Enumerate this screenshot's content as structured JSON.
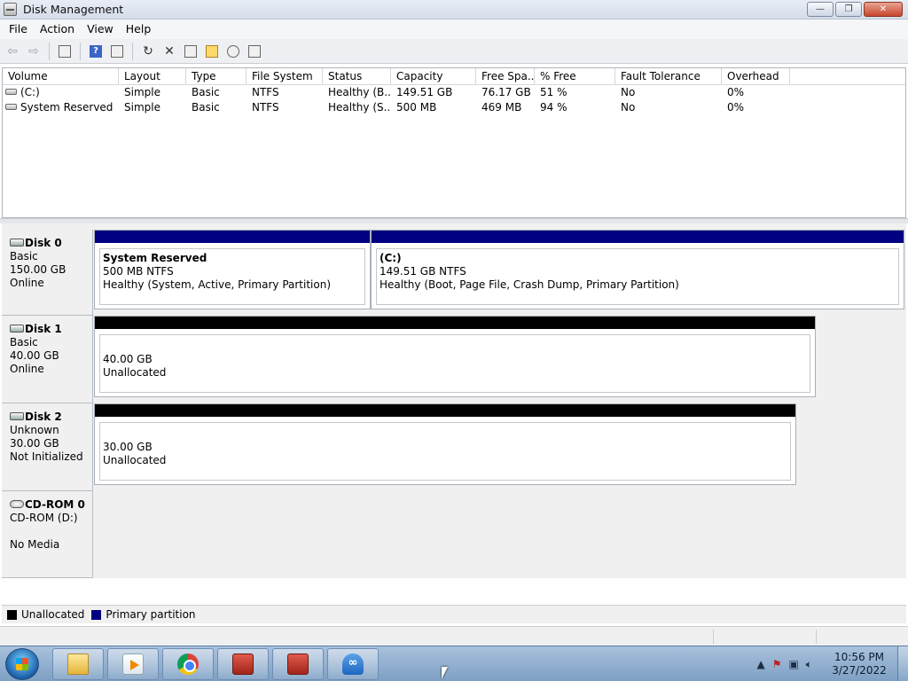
{
  "window": {
    "title": "Disk Management",
    "minimize": "—",
    "maximize": "❐",
    "close": "✕"
  },
  "menu": [
    "File",
    "Action",
    "View",
    "Help"
  ],
  "toolbar": {
    "back": "⇦",
    "forward": "⇨",
    "refresh": "↻",
    "delete": "✕",
    "help": "?"
  },
  "volumes": {
    "columns": [
      "Volume",
      "Layout",
      "Type",
      "File System",
      "Status",
      "Capacity",
      "Free Spa...",
      "% Free",
      "Fault Tolerance",
      "Overhead"
    ],
    "rows": [
      [
        "(C:)",
        "Simple",
        "Basic",
        "NTFS",
        "Healthy (B...",
        "149.51 GB",
        "76.17 GB",
        "51 %",
        "No",
        "0%"
      ],
      [
        "System Reserved",
        "Simple",
        "Basic",
        "NTFS",
        "Healthy (S...",
        "500 MB",
        "469 MB",
        "94 %",
        "No",
        "0%"
      ]
    ]
  },
  "disks": [
    {
      "name": "Disk 0",
      "type": "Basic",
      "size": "150.00 GB",
      "state": "Online",
      "partitions": [
        {
          "name": "System Reserved",
          "size": "500 MB NTFS",
          "status": "Healthy (System, Active, Primary Partition)"
        },
        {
          "name": "(C:)",
          "size": "149.51 GB NTFS",
          "status": "Healthy (Boot, Page File, Crash Dump, Primary Partition)"
        }
      ]
    },
    {
      "name": "Disk 1",
      "type": "Basic",
      "size": "40.00 GB",
      "state": "Online",
      "partitions": [
        {
          "size": "40.00 GB",
          "status": "Unallocated"
        }
      ]
    },
    {
      "name": "Disk 2",
      "type": "Unknown",
      "size": "30.00 GB",
      "state": "Not Initialized",
      "partitions": [
        {
          "size": "30.00 GB",
          "status": "Unallocated"
        }
      ]
    },
    {
      "name": "CD-ROM 0",
      "type": "CD-ROM (D:)",
      "size": "",
      "state": "No Media",
      "partitions": []
    }
  ],
  "legend": [
    {
      "label": "Unallocated",
      "color": "#000000"
    },
    {
      "label": "Primary partition",
      "color": "#000080"
    }
  ],
  "taskbar": {
    "apps": [
      "Windows Explorer",
      "Windows Media Player",
      "Google Chrome",
      "Toolbox",
      "Toolbox",
      "Cloud Download"
    ],
    "clock": {
      "time": "10:56 PM",
      "date": "3/27/2022"
    }
  },
  "colors": {
    "primary_partition": "#000080",
    "unallocated": "#000000",
    "taskbar": "#8fb0d4"
  }
}
